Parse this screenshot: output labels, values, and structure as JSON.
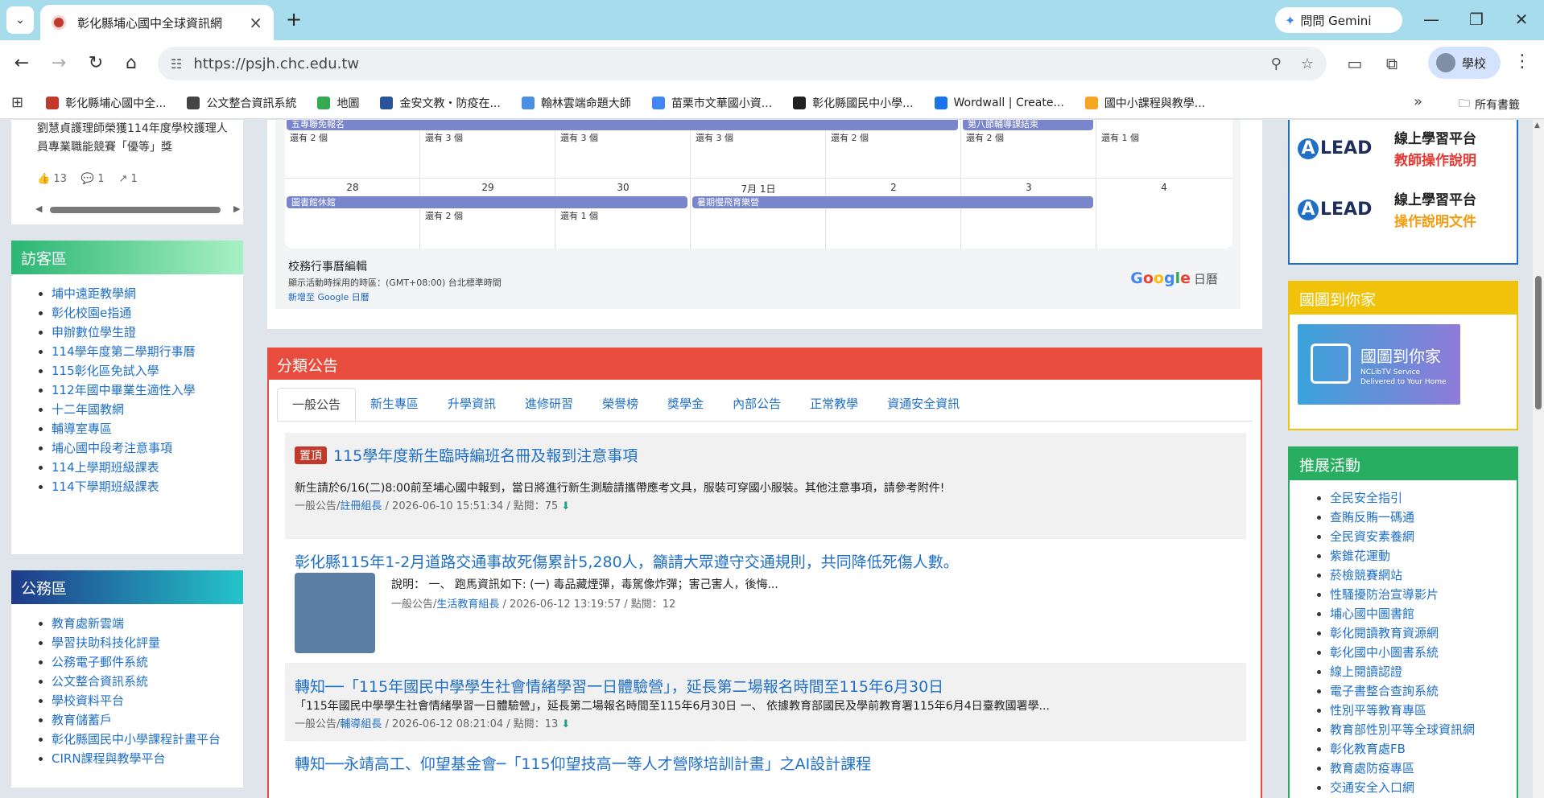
{
  "browser": {
    "tab_title": "彰化縣埔心國中全球資訊網",
    "gemini_label": "問問 Gemini",
    "url": "https://psjh.chc.edu.tw",
    "profile_label": "學校",
    "bookmarks": [
      {
        "label": "彰化縣埔心國中全...",
        "color": "#c0392b"
      },
      {
        "label": "公文整合資訊系統",
        "color": "#444444"
      },
      {
        "label": "地圖",
        "color": "#34a853"
      },
      {
        "label": "金安文教・防疫在...",
        "color": "#2a5298"
      },
      {
        "label": "翰林雲端命題大師",
        "color": "#4a90e2"
      },
      {
        "label": "苗栗市文華國小資...",
        "color": "#4285f4"
      },
      {
        "label": "彰化縣國民中小學...",
        "color": "#222222"
      },
      {
        "label": "Wordwall | Create...",
        "color": "#1a73e8"
      },
      {
        "label": "國中小課程與教學...",
        "color": "#f5a623"
      }
    ],
    "bookmarks_folder": "所有書籤"
  },
  "left": {
    "top_card_text": "劉慧貞護理師榮獲114年度學校護理人員專業職能競賽「優等」獎",
    "top_card_likes": "13",
    "top_card_comments": "1",
    "top_card_shares": "1",
    "visitor_title": "訪客區",
    "visitor_links": [
      "埔中遠距教學網",
      "彰化校園e指通",
      "申辦數位學生證",
      "114學年度第二學期行事曆",
      "115彰化區免試入學",
      "112年國中畢業生適性入學",
      "十二年國教網",
      "輔導室專區",
      "埔心國中段考注意事項",
      "114上學期班級課表",
      "114下學期班級課表"
    ],
    "official_title": "公務區",
    "official_links": [
      "教育處新雲端",
      "學習扶助科技化評量",
      "公務電子郵件系統",
      "公文整合資訊系統",
      "學校資料平台",
      "教育儲蓄戶",
      "彰化縣國民中小學課程計畫平台",
      "CIRN課程與教學平台"
    ]
  },
  "calendar": {
    "row1": {
      "events": [
        {
          "label": "五專聯免報名",
          "col": 0,
          "span": 5
        },
        {
          "label": "第八節輔導課結束",
          "col": 5,
          "span": 1
        }
      ],
      "notes": [
        "還有 2 個",
        "還有 3 個",
        "還有 3 個",
        "還有 3 個",
        "還有 2 個",
        "還有 2 個",
        "還有 1 個"
      ]
    },
    "row2": {
      "dates": [
        "28",
        "29",
        "30",
        "7月 1日",
        "2",
        "3",
        "4"
      ],
      "events": [
        {
          "label": "圖書館休館",
          "col": 0,
          "span": 3
        },
        {
          "label": "暑期慢飛育樂營",
          "col": 3,
          "span": 3
        }
      ],
      "notes": [
        "",
        "還有 2 個",
        "還有 1 個",
        "",
        "",
        "",
        ""
      ]
    },
    "footer_title": "校務行事曆編輯",
    "footer_tz": "顯示活動時採用的時區：(GMT+08:00) 台北標準時間",
    "footer_add": "新增至 Google 日曆",
    "google_label": "Google",
    "google_cal": "日曆"
  },
  "announcements": {
    "title": "分類公告",
    "tabs": [
      "一般公告",
      "新生專區",
      "升學資訊",
      "進修研習",
      "榮譽榜",
      "獎學金",
      "內部公告",
      "正常教學",
      "資通安全資訊"
    ],
    "items": [
      {
        "pinned": "置頂",
        "title": "115學年度新生臨時編班名冊及報到注意事項",
        "desc": "新生請於6/16(二)8:00前至埔心國中報到，當日將進行新生測驗請攜帶應考文具，服裝可穿國小服裝。其他注意事項，請參考附件!",
        "category": "一般公告/",
        "author": "註冊組長",
        "date": " / 2026-06-10 15:51:34 / 點閱：75"
      },
      {
        "title": "彰化縣115年1-2月道路交通事故死傷累計5,280人，籲請大眾遵守交通規則，共同降低死傷人數。",
        "desc": "說明： 一、 跑馬資訊如下: (一) 毒品藏煙彈，毒駕像炸彈；害己害人，後悔...",
        "category": "一般公告/",
        "author": "生活教育組長",
        "date": " / 2026-06-12 13:19:57 / 點閱：12"
      },
      {
        "title": "轉知──「115年國民中學學生社會情緒學習一日體驗營」，延長第二場報名時間至115年6月30日",
        "desc": "「115年國民中學學生社會情緒學習一日體驗營」，延長第二場報名時間至115年6月30日 一、 依據教育部國民及學前教育署115年6月4日臺教國署學...",
        "category": "一般公告/",
        "author": "輔導組長",
        "date": " / 2026-06-12 08:21:04 / 點閱：13"
      },
      {
        "title": "轉知──永靖高工、仰望基金會─「115仰望技高一等人才營隊培訓計畫」之AI設計課程"
      }
    ]
  },
  "right": {
    "lead_items": [
      {
        "logo": "LEAD",
        "line1": "線上學習平台",
        "line2": "教師操作說明",
        "color2": "#e53935"
      },
      {
        "logo": "LEAD",
        "line1": "線上學習平台",
        "line2": "操作說明文件",
        "color2": "#f39c12"
      }
    ],
    "ncl_title": "國圖到你家",
    "ncl_banner_title": "國圖到你家",
    "ncl_banner_sub1": "NCLibTV Service",
    "ncl_banner_sub2": "Delivered to Your Home",
    "promo_title": "推展活動",
    "promo_links": [
      "全民安全指引",
      "查賄反賄一碼通",
      "全民資安素養網",
      "紫錐花運動",
      "菸檢競賽網站",
      "性騷擾防治宣導影片",
      "埔心國中圖書館",
      "彰化閱讀教育資源網",
      "彰化國中小圖書系統",
      "線上閱讀認證",
      "電子書整合查詢系統",
      "性別平等教育專區",
      "教育部性別平等全球資訊網",
      "彰化教育處FB",
      "教育處防疫專區",
      "交通安全入口網"
    ]
  }
}
